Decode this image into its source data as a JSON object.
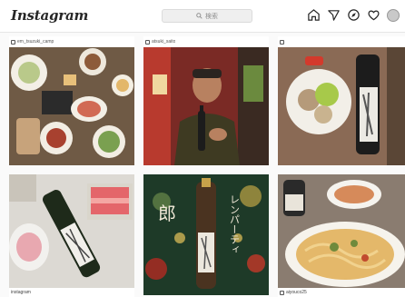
{
  "header": {
    "logo": "Instagram",
    "search_placeholder": "検索",
    "icons": [
      "home-icon",
      "direct-icon",
      "explore-icon",
      "heart-icon",
      "avatar"
    ]
  },
  "posts": [
    {
      "user": "em_tsuzuki_camp",
      "caption": "",
      "foot_user": ""
    },
    {
      "user": "atsuki_saito",
      "caption": "",
      "foot_user": ""
    },
    {
      "user": "",
      "caption": "",
      "foot_user": ""
    },
    {
      "user": "",
      "caption": "",
      "foot_user": "instagram"
    },
    {
      "user": "",
      "caption": "レンパーティ",
      "foot_user": ""
    },
    {
      "user": "",
      "caption": "",
      "foot_user": "aiyouco25"
    }
  ],
  "colors": {
    "accent": "#262626",
    "border": "#dbdbdb"
  }
}
